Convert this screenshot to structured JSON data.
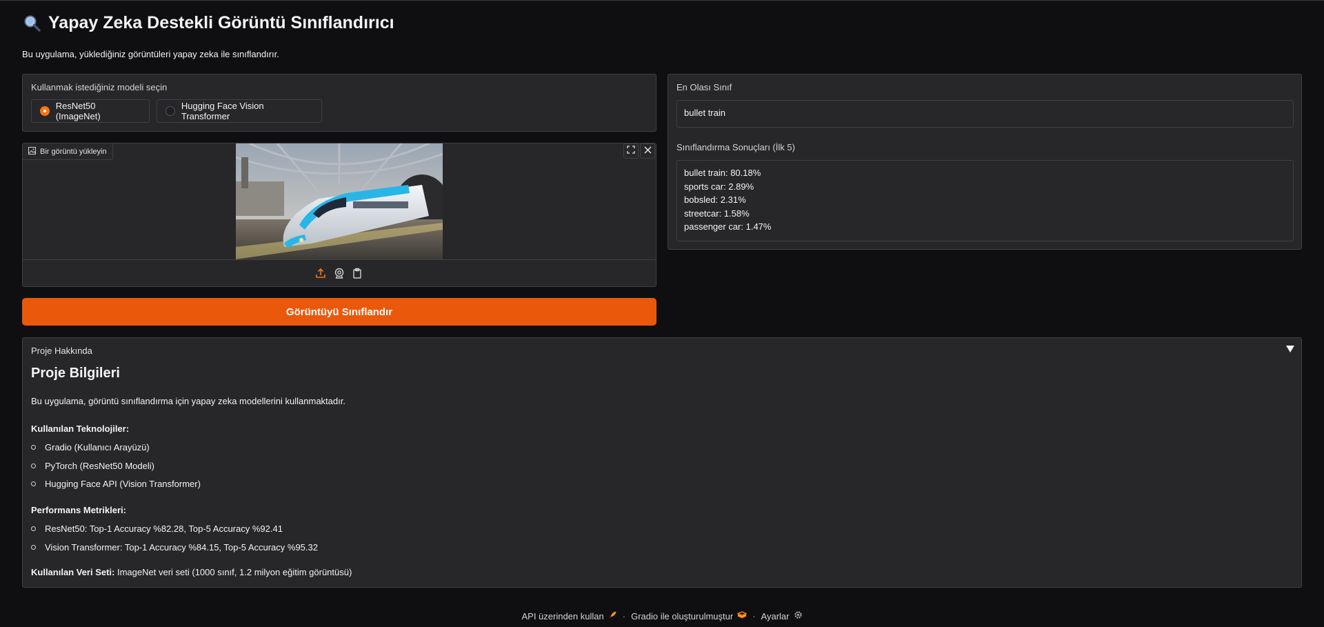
{
  "app": {
    "title": "Yapay Zeka Destekli Görüntü Sınıflandırıcı",
    "description": "Bu uygulama, yüklediğiniz görüntüleri yapay zeka ile sınıflandırır."
  },
  "model_select": {
    "label": "Kullanmak istediğiniz modeli seçin",
    "options": [
      "ResNet50 (ImageNet)",
      "Hugging Face Vision Transformer"
    ],
    "selected": "ResNet50 (ImageNet)"
  },
  "image_upload": {
    "label": "Bir görüntü yükleyin",
    "fullscreen_icon": "fullscreen-icon",
    "close_icon": "close-icon",
    "source_icons": [
      "upload-icon",
      "webcam-icon",
      "clipboard-icon"
    ],
    "accent": "#f97316"
  },
  "submit": {
    "label": "Görüntüyü Sınıflandır",
    "color": "#ea580c"
  },
  "prediction": {
    "label": "En Olası Sınıf",
    "value": "bullet train"
  },
  "top5": {
    "label": "Sınıflandırma Sonuçları (İlk 5)",
    "lines": [
      "bullet train: 80.18%",
      "sports car: 2.89%",
      "bobsled: 2.31%",
      "streetcar: 1.58%",
      "passenger car: 1.47%"
    ]
  },
  "about": {
    "accordion_label": "Proje Hakkında",
    "heading": "Proje Bilgileri",
    "intro": "Bu uygulama, görüntü sınıflandırma için yapay zeka modellerini kullanmaktadır.",
    "tech_heading": "Kullanılan Teknolojiler:",
    "tech": [
      "Gradio (Kullanıcı Arayüzü)",
      "PyTorch (ResNet50 Modeli)",
      "Hugging Face API (Vision Transformer)"
    ],
    "metrics_heading": "Performans Metrikleri:",
    "metrics": [
      "ResNet50: Top-1 Accuracy %82.28, Top-5 Accuracy %92.41",
      "Vision Transformer: Top-1 Accuracy %84.15, Top-5 Accuracy %95.32"
    ],
    "dataset_label": "Kullanılan Veri Seti:",
    "dataset_value": " ImageNet veri seti (1000 sınıf, 1.2 milyon eğitim görüntüsü)"
  },
  "footer": {
    "api": "API üzerinden kullan",
    "built": "Gradio ile oluşturulmuştur",
    "settings": "Ayarlar",
    "separator": "·"
  }
}
